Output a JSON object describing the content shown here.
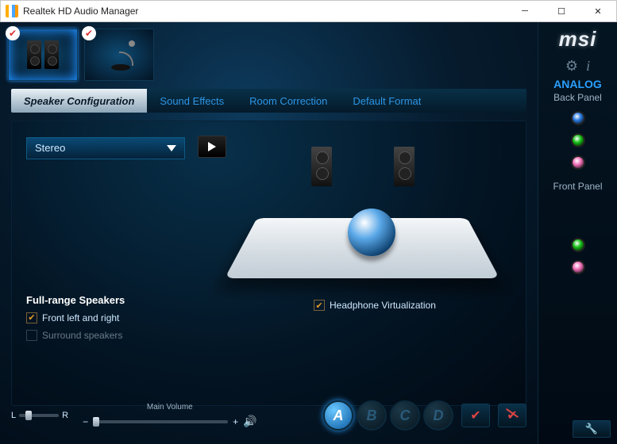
{
  "window": {
    "title": "Realtek HD Audio Manager"
  },
  "brand": "msi",
  "devices": {
    "speakers_checked": true,
    "mic_checked": true
  },
  "tabs": [
    {
      "label": "Speaker Configuration",
      "active": true
    },
    {
      "label": "Sound Effects",
      "active": false
    },
    {
      "label": "Room Correction",
      "active": false
    },
    {
      "label": "Default Format",
      "active": false
    }
  ],
  "config": {
    "mode_selected": "Stereo",
    "full_range_title": "Full-range Speakers",
    "front_lr": {
      "label": "Front left and right",
      "checked": true,
      "enabled": true
    },
    "surround": {
      "label": "Surround speakers",
      "checked": false,
      "enabled": false
    },
    "hp_virt": {
      "label": "Headphone Virtualization",
      "checked": true
    }
  },
  "footer": {
    "balance": {
      "left_label": "L",
      "right_label": "R"
    },
    "main_volume_label": "Main Volume",
    "presets": [
      "A",
      "B",
      "C",
      "D"
    ],
    "preset_active": "A"
  },
  "side": {
    "analog_label": "ANALOG",
    "back_panel_label": "Back Panel",
    "front_panel_label": "Front Panel",
    "back_jacks": [
      "blue",
      "green",
      "pink"
    ],
    "front_jacks": [
      "green",
      "pink"
    ]
  }
}
